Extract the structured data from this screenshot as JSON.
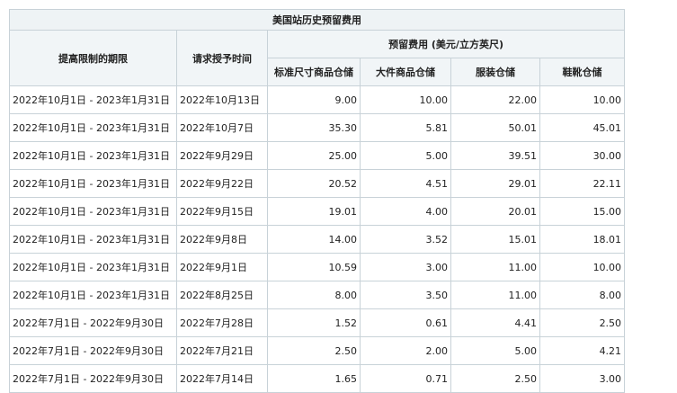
{
  "table": {
    "title": "美国站历史预留费用",
    "headers": {
      "period": "提高限制的期限",
      "grant_time": "请求授予时间",
      "fee_group": "预留费用 (美元/立方英尺)",
      "standard": "标准尺寸商品仓储",
      "oversize": "大件商品仓储",
      "apparel": "服装仓储",
      "footwear": "鞋靴仓储"
    },
    "rows": [
      {
        "period": "2022年10月1日 - 2023年1月31日",
        "grant": "2022年10月13日",
        "standard": "9.00",
        "oversize": "10.00",
        "apparel": "22.00",
        "footwear": "10.00"
      },
      {
        "period": "2022年10月1日 - 2023年1月31日",
        "grant": "2022年10月7日",
        "standard": "35.30",
        "oversize": "5.81",
        "apparel": "50.01",
        "footwear": "45.01"
      },
      {
        "period": "2022年10月1日 - 2023年1月31日",
        "grant": "2022年9月29日",
        "standard": "25.00",
        "oversize": "5.00",
        "apparel": "39.51",
        "footwear": "30.00"
      },
      {
        "period": "2022年10月1日 - 2023年1月31日",
        "grant": "2022年9月22日",
        "standard": "20.52",
        "oversize": "4.51",
        "apparel": "29.01",
        "footwear": "22.11"
      },
      {
        "period": "2022年10月1日 - 2023年1月31日",
        "grant": "2022年9月15日",
        "standard": "19.01",
        "oversize": "4.00",
        "apparel": "20.01",
        "footwear": "15.00"
      },
      {
        "period": "2022年10月1日 - 2023年1月31日",
        "grant": "2022年9月8日",
        "standard": "14.00",
        "oversize": "3.52",
        "apparel": "15.01",
        "footwear": "18.01"
      },
      {
        "period": "2022年10月1日 - 2023年1月31日",
        "grant": "2022年9月1日",
        "standard": "10.59",
        "oversize": "3.00",
        "apparel": "11.00",
        "footwear": "10.00"
      },
      {
        "period": "2022年10月1日 - 2023年1月31日",
        "grant": "2022年8月25日",
        "standard": "8.00",
        "oversize": "3.50",
        "apparel": "11.00",
        "footwear": "8.00"
      },
      {
        "period": "2022年7月1日 - 2022年9月30日",
        "grant": "2022年7月28日",
        "standard": "1.52",
        "oversize": "0.61",
        "apparel": "4.41",
        "footwear": "2.50"
      },
      {
        "period": "2022年7月1日 - 2022年9月30日",
        "grant": "2022年7月21日",
        "standard": "2.50",
        "oversize": "2.00",
        "apparel": "5.00",
        "footwear": "4.21"
      },
      {
        "period": "2022年7月1日 - 2022年9月30日",
        "grant": "2022年7月14日",
        "standard": "1.65",
        "oversize": "0.71",
        "apparel": "2.50",
        "footwear": "3.00"
      }
    ]
  },
  "colors": {
    "border": "#c8d2d8",
    "header_bg": "#f1f5f7"
  }
}
